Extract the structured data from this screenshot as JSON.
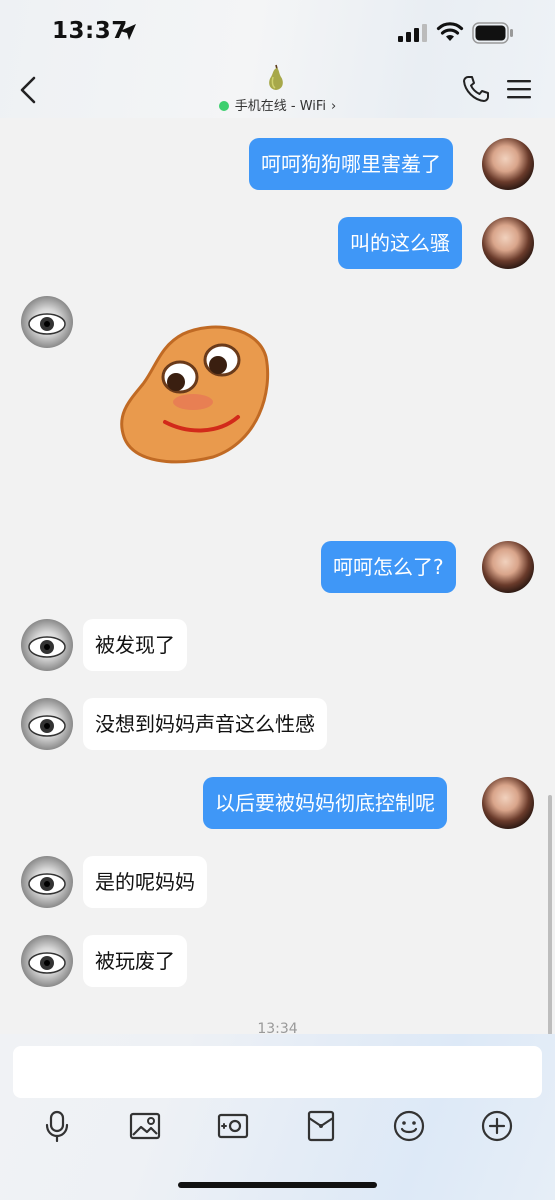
{
  "status_bar": {
    "time": "13:37"
  },
  "header": {
    "contact_status": "手机在线 - WiFi",
    "status_color": "#3ccf6e"
  },
  "messages": [
    {
      "direction": "out",
      "text": "呵呵狗狗哪里害羞了"
    },
    {
      "direction": "out",
      "text": "叫的这么骚"
    },
    {
      "direction": "in",
      "type": "sticker",
      "sticker": "orange-blob-smiling-sticker"
    },
    {
      "direction": "out",
      "text": "呵呵怎么了?"
    },
    {
      "direction": "in",
      "text": "被发现了"
    },
    {
      "direction": "in",
      "text": "没想到妈妈声音这么性感"
    },
    {
      "direction": "out",
      "text": "以后要被妈妈彻底控制呢"
    },
    {
      "direction": "in",
      "text": "是的呢妈妈"
    },
    {
      "direction": "in",
      "text": "被玩废了"
    }
  ],
  "timestamp": "13:34",
  "input": {
    "value": ""
  },
  "toolbar": {
    "icons": [
      "microphone-icon",
      "image-icon",
      "camera-icon",
      "red-packet-icon",
      "emoji-icon",
      "plus-icon"
    ]
  },
  "colors": {
    "outgoing_bubble": "#3f97f7",
    "incoming_bubble": "#ffffff",
    "chat_background": "#f2f2f2"
  }
}
